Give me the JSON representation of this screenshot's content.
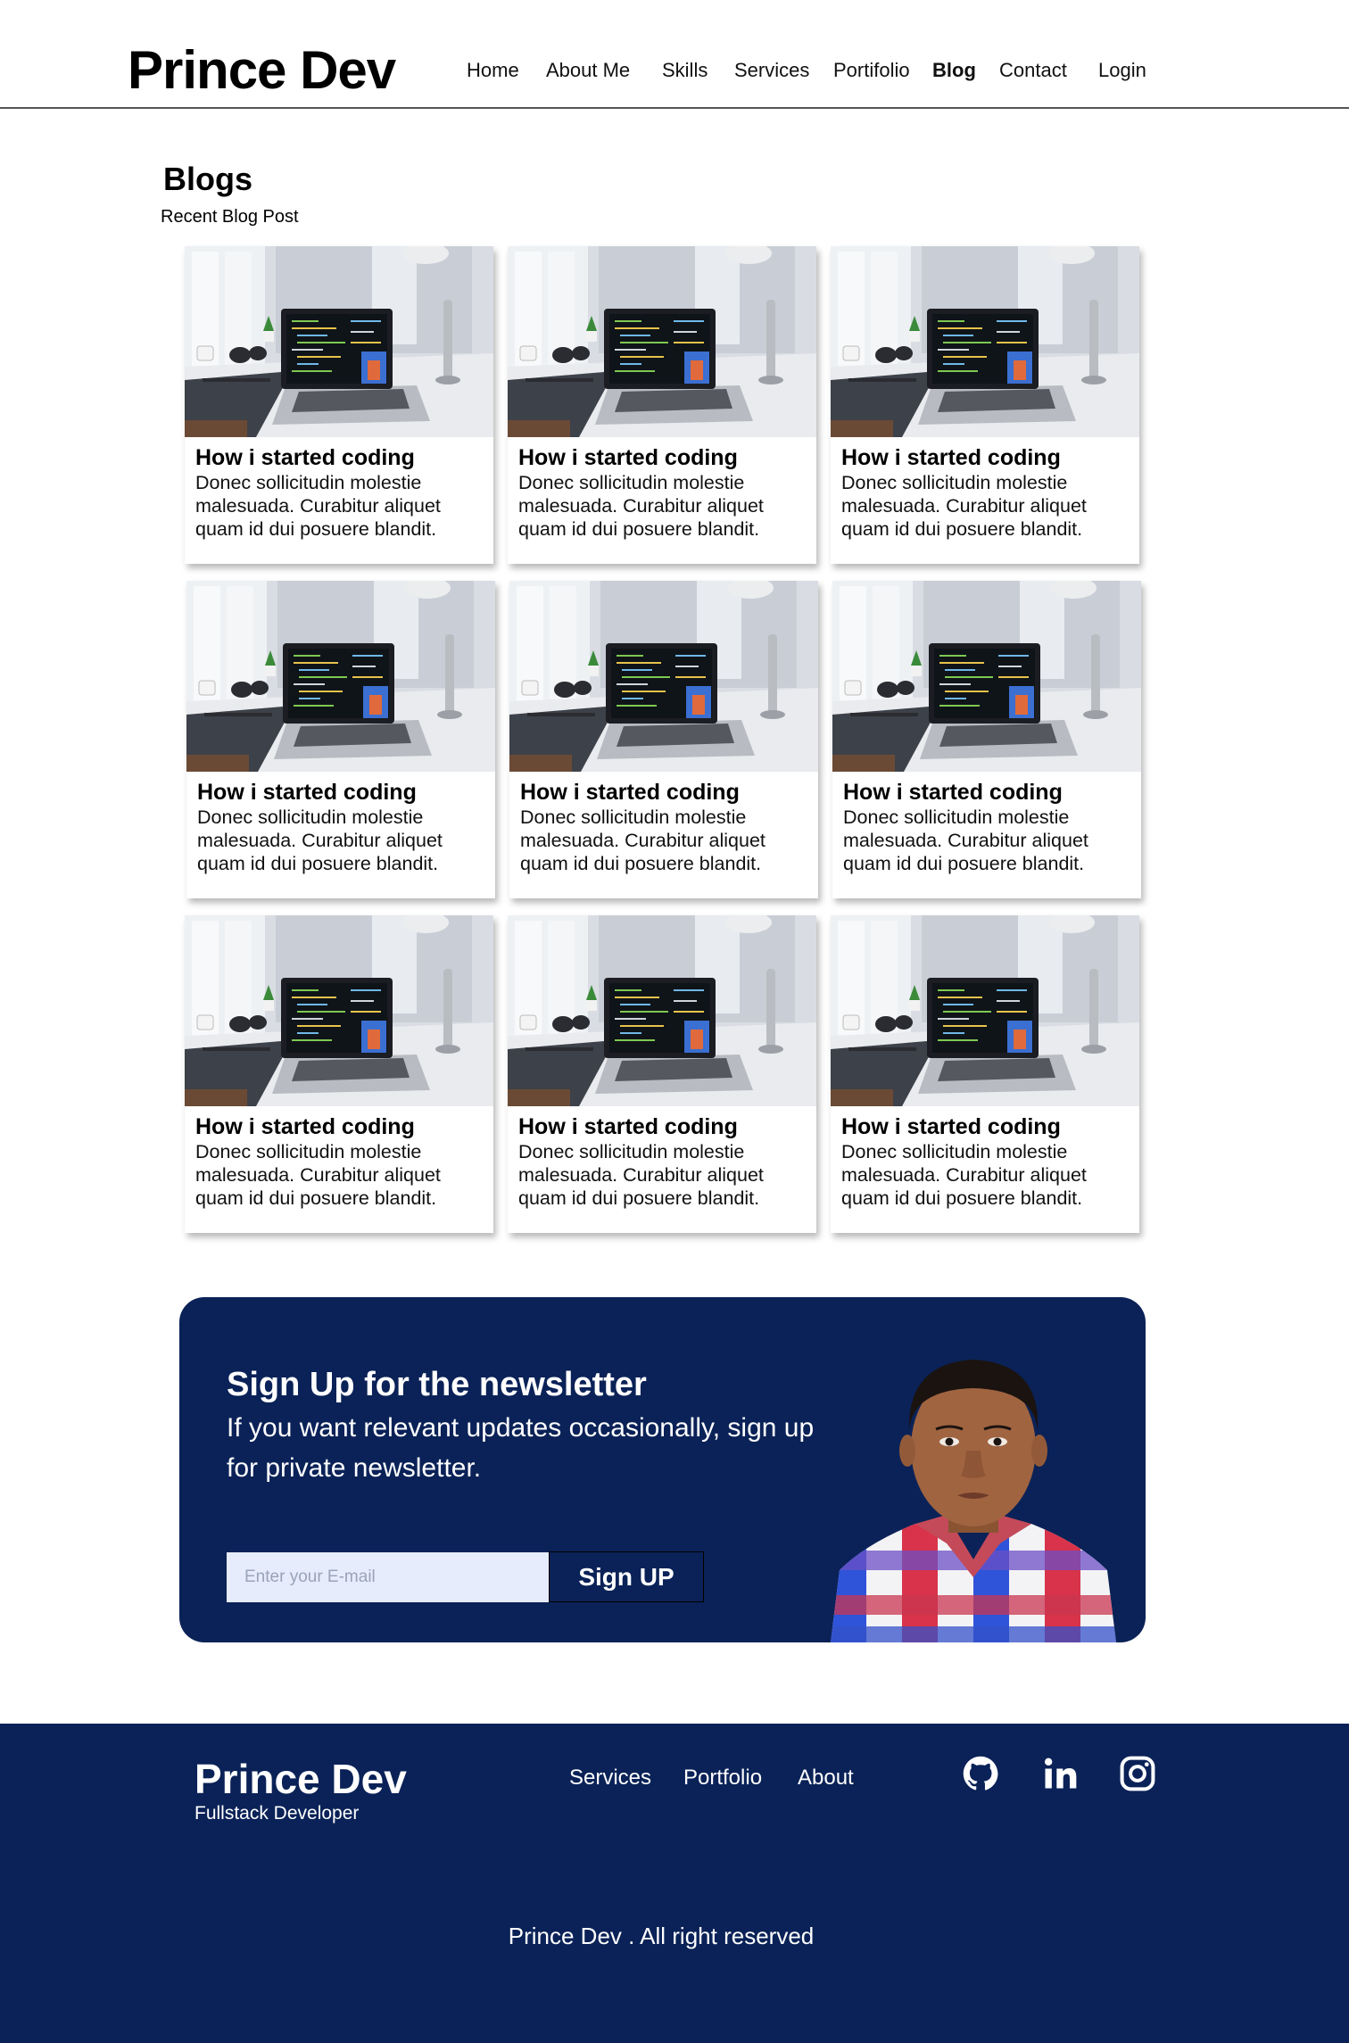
{
  "header": {
    "logo": "Prince Dev",
    "nav": [
      {
        "label": "Home"
      },
      {
        "label": "About Me"
      },
      {
        "label": "Skills"
      },
      {
        "label": "Services"
      },
      {
        "label": "Portifolio"
      },
      {
        "label": "Blog",
        "active": true
      },
      {
        "label": "Contact"
      },
      {
        "label": "Login"
      }
    ]
  },
  "blogs": {
    "title": "Blogs",
    "subtitle": "Recent Blog Post",
    "posts": [
      {
        "title": "How i started coding",
        "text": "Donec sollicitudin molestie malesuada. Curabitur aliquet quam id dui posuere blandit."
      },
      {
        "title": "How i started coding",
        "text": "Donec sollicitudin molestie malesuada. Curabitur aliquet quam id dui posuere blandit."
      },
      {
        "title": "How i started coding",
        "text": "Donec sollicitudin molestie malesuada. Curabitur aliquet quam id dui posuere blandit."
      },
      {
        "title": "How i started coding",
        "text": "Donec sollicitudin molestie malesuada. Curabitur aliquet quam id dui posuere blandit."
      },
      {
        "title": "How i started coding",
        "text": "Donec sollicitudin molestie malesuada. Curabitur aliquet quam id dui posuere blandit."
      },
      {
        "title": "How i started coding",
        "text": "Donec sollicitudin molestie malesuada. Curabitur aliquet quam id dui posuere blandit."
      },
      {
        "title": "How i started coding",
        "text": "Donec sollicitudin molestie malesuada. Curabitur aliquet quam id dui posuere blandit."
      },
      {
        "title": "How i started coding",
        "text": "Donec sollicitudin molestie malesuada. Curabitur aliquet quam id dui posuere blandit."
      },
      {
        "title": "How i started coding",
        "text": "Donec sollicitudin molestie malesuada. Curabitur aliquet quam id dui posuere blandit."
      }
    ]
  },
  "newsletter": {
    "title": "Sign Up for the newsletter",
    "text": "If you want relevant updates occasionally, sign up for private newsletter.",
    "placeholder": "Enter your E-mail",
    "button": "Sign UP"
  },
  "footer": {
    "logo": "Prince Dev",
    "tagline": "Fullstack Developer",
    "links": [
      {
        "label": "Services"
      },
      {
        "label": "Portfolio"
      },
      {
        "label": "About"
      }
    ],
    "icons": [
      "github-icon",
      "linkedin-icon",
      "instagram-icon"
    ],
    "copyright": "Prince Dev . All right reserved"
  },
  "colors": {
    "navy": "#0a2257",
    "input_bg": "#e6ecfb"
  }
}
